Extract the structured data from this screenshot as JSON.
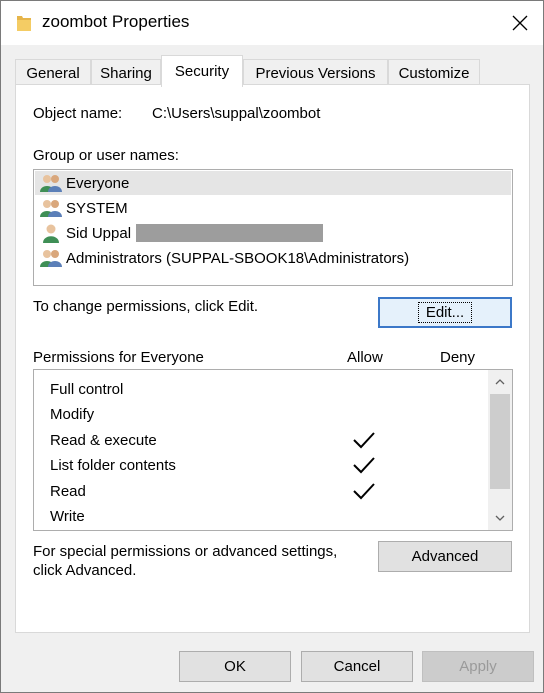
{
  "window": {
    "title": "zoombot Properties"
  },
  "tabs": [
    {
      "label": "General"
    },
    {
      "label": "Sharing"
    },
    {
      "label": "Security"
    },
    {
      "label": "Previous Versions"
    },
    {
      "label": "Customize"
    }
  ],
  "active_tab": "Security",
  "object": {
    "label": "Object name:",
    "value": "C:\\Users\\suppal\\zoombot"
  },
  "group": {
    "label": "Group or user names:",
    "items": [
      {
        "name": "Everyone",
        "icon": "group-users-icon",
        "selected": true
      },
      {
        "name": "SYSTEM",
        "icon": "group-users-icon"
      },
      {
        "name": "Sid Uppal",
        "icon": "user-icon",
        "redacted": true
      },
      {
        "name": "Administrators (SUPPAL-SBOOK18\\Administrators)",
        "icon": "group-users-icon"
      }
    ]
  },
  "change_hint": "To change permissions, click Edit.",
  "edit_button": "Edit...",
  "permissions": {
    "label": "Permissions for Everyone",
    "allow_header": "Allow",
    "deny_header": "Deny",
    "rows": [
      {
        "name": "Full control",
        "allow": false,
        "deny": false
      },
      {
        "name": "Modify",
        "allow": false,
        "deny": false
      },
      {
        "name": "Read & execute",
        "allow": true,
        "deny": false
      },
      {
        "name": "List folder contents",
        "allow": true,
        "deny": false
      },
      {
        "name": "Read",
        "allow": true,
        "deny": false
      },
      {
        "name": "Write",
        "allow": false,
        "deny": false
      }
    ]
  },
  "special": {
    "line1": "For special permissions or advanced settings,",
    "line2": "click Advanced."
  },
  "advanced_button": "Advanced",
  "footer": {
    "ok": "OK",
    "cancel": "Cancel",
    "apply": "Apply"
  },
  "colors": {
    "focus_border": "#3c78c8",
    "selection": "#e5e5e5",
    "dialog_bg": "#f0f0f0"
  }
}
